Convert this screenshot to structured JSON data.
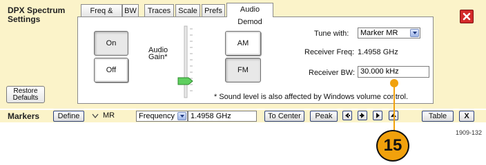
{
  "panel": {
    "title": "DPX Spectrum Settings",
    "tabs": [
      {
        "label": "Freq & Span"
      },
      {
        "label": "BW"
      },
      {
        "label": "Traces"
      },
      {
        "label": "Scale"
      },
      {
        "label": "Prefs"
      },
      {
        "label": "Audio Demod"
      }
    ],
    "active_tab": "Audio Demod",
    "restore_label": "Restore Defaults"
  },
  "audio_demod": {
    "on_label": "On",
    "off_label": "Off",
    "audio_gain_label": "Audio Gain*",
    "am_label": "AM",
    "fm_label": "FM",
    "tune_with_label": "Tune with:",
    "tune_with_value": "Marker MR",
    "receiver_freq_label": "Receiver Freq:",
    "receiver_freq_value": "1.4958 GHz",
    "receiver_bw_label": "Receiver BW:",
    "receiver_bw_value": "30.000 kHz",
    "note": "* Sound level is also affected by Windows volume control."
  },
  "markers": {
    "title": "Markers",
    "define_label": "Define",
    "marker_value": "MR",
    "readout_select": "Frequency",
    "readout_value": "1.4958 GHz",
    "to_center_label": "To Center",
    "peak_label": "Peak",
    "table_label": "Table",
    "close_label": "X"
  },
  "figure_id": "1909-132",
  "callout_number": "15",
  "colors": {
    "panel_bg": "#fbf3c9",
    "close_red": "#d32a2a",
    "callout": "#f1a10c",
    "slider_handle": "#5fcf5f"
  }
}
